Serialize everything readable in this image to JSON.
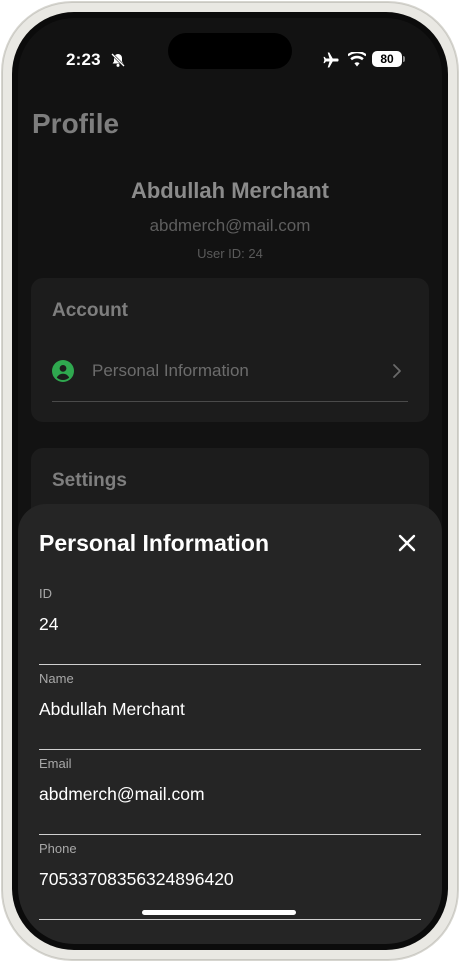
{
  "status_bar": {
    "time": "2:23",
    "battery": "80",
    "icons": [
      "bell-off-icon",
      "airplane-icon",
      "wifi-icon",
      "battery-icon"
    ]
  },
  "profile": {
    "title": "Profile",
    "name": "Abdullah Merchant",
    "email": "abdmerch@mail.com",
    "user_id": "User ID: 24"
  },
  "account": {
    "heading": "Account",
    "items": [
      {
        "label": "Personal Information",
        "icon": "person-icon"
      }
    ]
  },
  "settings": {
    "heading": "Settings"
  },
  "sheet": {
    "title": "Personal Information",
    "fields": [
      {
        "label": "ID",
        "value": "24"
      },
      {
        "label": "Name",
        "value": "Abdullah Merchant"
      },
      {
        "label": "Email",
        "value": "abdmerch@mail.com"
      },
      {
        "label": "Phone",
        "value": "70533708356324896420"
      }
    ]
  },
  "colors": {
    "background": "#121212",
    "sheet": "#252525",
    "accent_green": "#2fa84f"
  }
}
